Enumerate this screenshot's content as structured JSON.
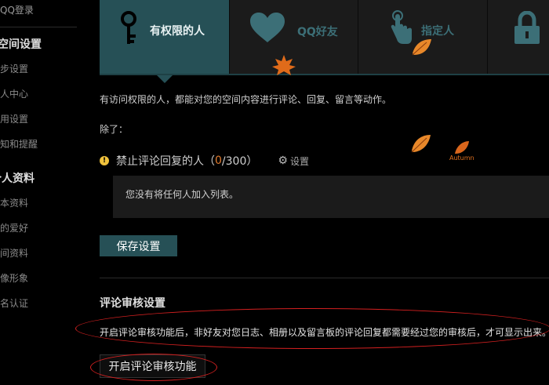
{
  "sidebar": {
    "top_link": "QQ登录",
    "sections": [
      {
        "title": "空间设置",
        "items": [
          "同步设置",
          "个人中心",
          "应用设置",
          "通知和提醒"
        ]
      },
      {
        "title": "个人资料",
        "items": [
          "基本资料",
          "我的爱好",
          "空间资料",
          "头像形象",
          "实名认证"
        ]
      }
    ]
  },
  "tabs": [
    {
      "label": "有权限的人",
      "icon": "key-icon"
    },
    {
      "label": "QQ好友",
      "icon": "heart-icon"
    },
    {
      "label": "指定人",
      "icon": "pointer-hand-icon"
    },
    {
      "label": "",
      "icon": "lock-icon"
    }
  ],
  "main": {
    "description": "有访问权限的人，都能对您的空间内容进行评论、回复、留言等动作。",
    "except_label": "除了：",
    "blocked": {
      "label": "禁止评论回复的人（",
      "count": "0",
      "total": "/300）",
      "settings_link": "设置"
    },
    "empty_list_text": "您没有将任何人加入列表。",
    "save_button": "保存设置"
  },
  "review": {
    "title": "评论审核设置",
    "description": "开启评论审核功能后，非好友对您日志、相册以及留言板的评论回复都需要经过您的审核后，才可显示出来。",
    "enable_button": "开启评论审核功能"
  },
  "decoration": {
    "autumn_text": "Autumn"
  },
  "colors": {
    "accent": "#265056",
    "tab_inactive": "#1b1b1b",
    "highlight_oval": "#d52020"
  }
}
